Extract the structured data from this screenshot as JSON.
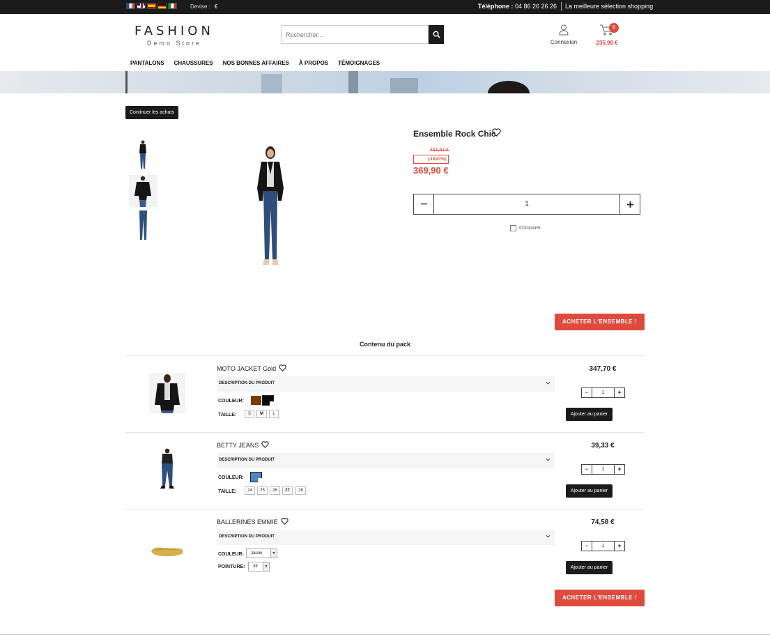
{
  "topbar": {
    "devise_label": "Devise :",
    "devise_value": "€",
    "phone_label": "Téléphone :",
    "phone_value": "04 86 26 26 26",
    "slogan": "La meilleure sélection shopping"
  },
  "header": {
    "logo_main": "FASHION",
    "logo_sub": "Demo Store",
    "search_placeholder": "Rechercher...",
    "account_label": "Connexion",
    "cart_count": "6",
    "cart_total": "235,98 €"
  },
  "nav": [
    "PANTALONS",
    "CHAUSSURES",
    "NOS BONNES AFFAIRES",
    "À PROPOS",
    "TÉMOIGNAGES"
  ],
  "continue_label": "Continuer les achats",
  "product": {
    "title": "Ensemble Rock Chic",
    "old_price": "461,61 €",
    "discount": "(-19.87%)",
    "price": "369,90 €",
    "quantity": "1",
    "compare_label": "Comparer"
  },
  "buy_label": "ACHETER L'ENSEMBLE !",
  "pack_title": "Contenu du pack",
  "colors": {
    "accent": "#e04a3d",
    "dark": "#1b1b1b"
  },
  "pack": [
    {
      "name": "MOTO JACKET Gold",
      "desc_label": "DESCRIPTION DU PRODUIT",
      "color_label": "COULEUR:",
      "size_label": "TAILLE:",
      "sizes": [
        "S",
        "M",
        "L"
      ],
      "price": "347,70 €",
      "quantity": "1",
      "add_label": "Ajouter au panier"
    },
    {
      "name": "BETTY JEANS",
      "desc_label": "DESCRIPTION DU PRODUIT",
      "color_label": "COULEUR:",
      "size_label": "TAILLE:",
      "sizes": [
        "24",
        "25",
        "26",
        "27",
        "28"
      ],
      "price": "39,33 €",
      "quantity": "1",
      "add_label": "Ajouter au panier"
    },
    {
      "name": "BALLERINES EMMIE",
      "desc_label": "DESCRIPTION DU PRODUIT",
      "color_label": "COULEUR:",
      "color_select": "Jaune",
      "size_label": "POINTURE:",
      "size_select": "38",
      "price": "74,58 €",
      "quantity": "1",
      "add_label": "Ajouter au panier"
    }
  ]
}
